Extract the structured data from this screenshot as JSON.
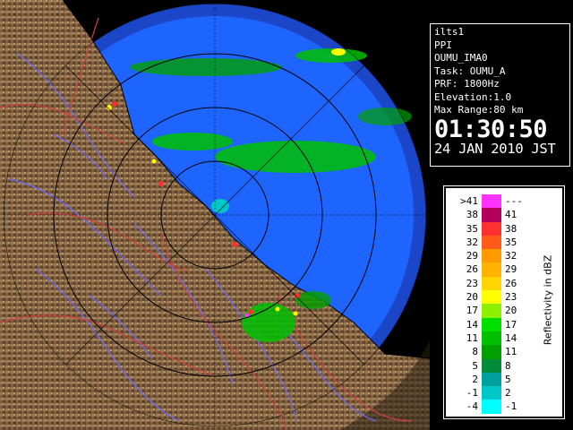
{
  "info": {
    "site": "ilts1",
    "product": "PPI",
    "station": "OUMU_IMA0",
    "task": "Task: OUMU_A",
    "prf": "PRF: 1800Hz",
    "elevation": "Elevation:1.0",
    "max_range": "Max Range:80 km",
    "time": "01:30:50",
    "date": "24 JAN 2010 JST"
  },
  "legend": {
    "axis_label": "Reflectivity in dBZ",
    "rows": [
      {
        "low": ">41",
        "high": "---",
        "color": "#ff33ff"
      },
      {
        "low": "38",
        "high": "41",
        "color": "#b3005a"
      },
      {
        "low": "35",
        "high": "38",
        "color": "#ff3030"
      },
      {
        "low": "32",
        "high": "35",
        "color": "#ff5a1a"
      },
      {
        "low": "29",
        "high": "32",
        "color": "#ff9a00"
      },
      {
        "low": "26",
        "high": "29",
        "color": "#ffb300"
      },
      {
        "low": "23",
        "high": "26",
        "color": "#ffd400"
      },
      {
        "low": "20",
        "high": "23",
        "color": "#ffff00"
      },
      {
        "low": "17",
        "high": "20",
        "color": "#8cf000"
      },
      {
        "low": "14",
        "high": "17",
        "color": "#00e000"
      },
      {
        "low": "11",
        "high": "14",
        "color": "#00c000"
      },
      {
        "low": "8",
        "high": "11",
        "color": "#00a000"
      },
      {
        "low": "5",
        "high": "8",
        "color": "#008a3a"
      },
      {
        "low": "2",
        "high": "5",
        "color": "#00a0a0"
      },
      {
        "low": "-1",
        "high": "2",
        "color": "#00c8c8"
      },
      {
        "low": "-4",
        "high": "-1",
        "color": "#00ffff"
      }
    ]
  },
  "colors": {
    "sea": "#1e64ff",
    "sea_outer": "#1c46c8",
    "land": "#8a6a48",
    "rivers": "#6a6aff",
    "borders": "#d04040",
    "range_rings": "#000000"
  }
}
